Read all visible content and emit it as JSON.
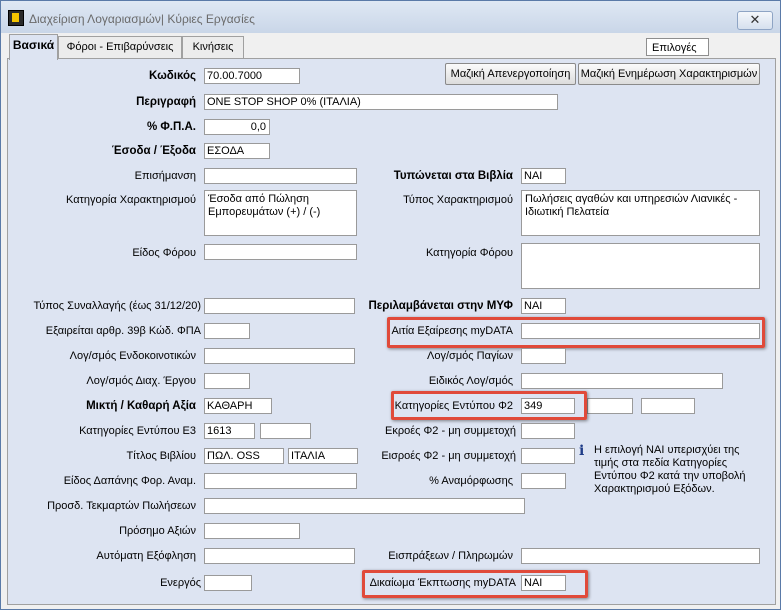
{
  "window": {
    "title": "Διαχείριση Λογαριασμών| Κύριες Εργασίες",
    "close_label": "✕"
  },
  "tabs": [
    "Βασικά",
    "Φόροι - Επιβαρύνσεις",
    "Κινήσεις"
  ],
  "options_label": "Επιλογές",
  "buttons": {
    "mass_deactivate": "Μαζική Απενεργοποίηση",
    "mass_update": "Μαζική Ενημέρωση Χαρακτηρισμών"
  },
  "labels": {
    "code": "Κωδικός",
    "description": "Περιγραφή",
    "vat": "% Φ.Π.Α.",
    "in_out": "Έσοδα / Έξοδα",
    "remark": "Επισήμανση",
    "char_category": "Κατηγορία Χαρακτηρισμού",
    "tax_type": "Είδος Φόρου",
    "printed_books": "Τυπώνεται στα Βιβλία",
    "char_type": "Τύπος Χαρακτηρισμού",
    "tax_category": "Κατηγορία Φόρου",
    "trans_type": "Τύπος Συναλλαγής (έως 31/12/20)",
    "art39b": "Εξαιρείται αρθρ. 39β Κώδ. ΦΠΑ",
    "intra_acc": "Λογ/σμός Ενδοκοινοτικών",
    "proj_acc": "Λογ/σμός Διαχ. Έργου",
    "net_value": "Μικτή  / Καθαρή Αξία",
    "e3_cat": "Κατηγορίες Εντύπου Ε3",
    "book_title": "Τίτλος Βιβλίου",
    "car_expense": "Είδος Δαπάνης Φορ. Αναμ.",
    "presumption": "Προσδ. Τεκμαρτών Πωλήσεων",
    "sign": "Πρόσημο Αξιών",
    "auto_pay": "Αυτόματη Εξόφληση",
    "active": "Ενεργός",
    "myf": "Περιλαμβάνεται στην ΜΥΦ",
    "exemption_cause": "Αιτία Εξαίρεσης myDATA",
    "fixed_acc": "Λογ/σμός  Παγίων",
    "special_acc": "Ειδικός Λογ/σμός",
    "f2_cat": "Κατηγορίες Εντύπου Φ2",
    "f2_out": "Εκροές Φ2 - μη συμμετοχή",
    "f2_in": "Εισροές Φ2 - μη συμμετοχή",
    "revaluation": "% Αναμόρφωσης",
    "receipts": "Εισπράξεων / Πληρωμών",
    "deduction_right": "Δικαίωμα Έκπτωσης myDATA"
  },
  "values": {
    "code": "70.00.7000",
    "description": "ONE STOP SHOP 0% (ΙΤΑΛΙΑ)",
    "vat": "0,0",
    "in_out": "ΕΣΟΔΑ",
    "char_category": "Έσοδα από Πώληση Εμπορευμάτων (+) / (-)",
    "printed_books": "ΝΑΙ",
    "char_type": "Πωλήσεις αγαθών και υπηρεσιών Λιανικές - Ιδιωτική Πελατεία",
    "myf": "ΝΑΙ",
    "net_value": "ΚΑΘΑΡΗ",
    "f2_cat": "349",
    "e3_cat": "1613",
    "book_title_1": "ΠΩΛ. OSS",
    "book_title_2": "ΙΤΑΛΙΑ",
    "deduction_right": "ΝΑΙ"
  },
  "note": "Η επιλογή ΝΑΙ υπερισχύει της τιμής στα πεδία Κατηγορίες Εντύπου Φ2 κατά την υποβολή Χαρακτηρισμού Εξόδων.",
  "colors": {
    "panel": "#dde4f2",
    "highlight": "#e04a3a"
  }
}
